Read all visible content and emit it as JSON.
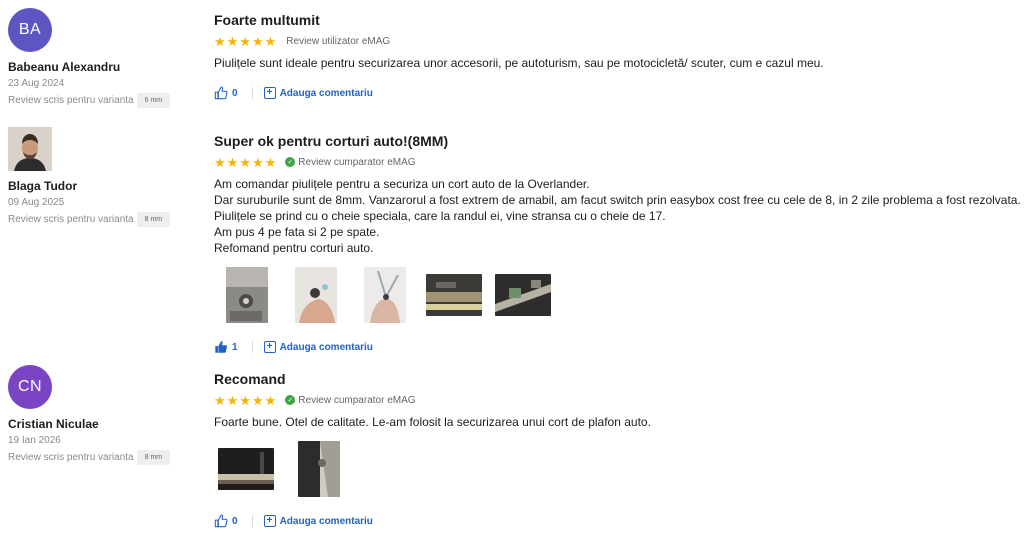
{
  "reviews": [
    {
      "avatar_initials": "BA",
      "avatar_color": "#5c55c2",
      "author": "Babeanu Alexandru",
      "date": "23 Aug 2024",
      "variant_label": "Review scris pentru varianta",
      "variant": "6 mm",
      "title": "Foarte multumit",
      "rating": 5,
      "badge": "Review utilizator eMAG",
      "verified": false,
      "body": [
        "Piulițele sunt ideale pentru securizarea unor accesorii, pe autoturism, sau pe motocicletă/ scuter, cum e cazul meu."
      ],
      "likes": "0",
      "liked": false,
      "comment_label": "Adauga comentariu"
    },
    {
      "avatar_icon": "user-photo",
      "author": "Blaga Tudor",
      "date": "09 Aug 2025",
      "variant_label": "Review scris pentru varianta",
      "variant": "8 mm",
      "title": "Super ok pentru corturi auto!(8MM)",
      "rating": 5,
      "badge": "Review cumparator eMAG",
      "verified": true,
      "body": [
        "Am comandar piulițele pentru a securiza un cort auto de la Overlander.",
        "Dar suruburile sunt de 8mm. Vanzarorul a fost extrem de amabil, am facut switch prin easybox cost free cu cele de 8, in 2 zile problema a fost rezolvata.",
        "Piulițele se prind cu o cheie speciala, care la randul ei, vine stransa cu o cheie de 17.",
        "Am pus 4 pe fata si 2 pe spate.",
        "Refomand pentru corturi auto."
      ],
      "likes": "1",
      "liked": true,
      "comment_label": "Adauga comentariu"
    },
    {
      "avatar_initials": "CN",
      "avatar_color": "#7a45c4",
      "author": "Cristian Niculae",
      "date": "19 Ian 2026",
      "variant_label": "Review scris pentru varianta",
      "variant": "8 mm",
      "title": "Recomand",
      "rating": 5,
      "badge": "Review cumparator eMAG",
      "verified": true,
      "body": [
        "Foarte bune. Otel de calitate. Le-am folosit la securizarea unui cort de plafon auto."
      ],
      "likes": "0",
      "liked": false,
      "comment_label": "Adauga comentariu"
    }
  ],
  "colors": {
    "link": "#2162c3",
    "star": "#f4b400",
    "verified": "#3ca34a"
  }
}
